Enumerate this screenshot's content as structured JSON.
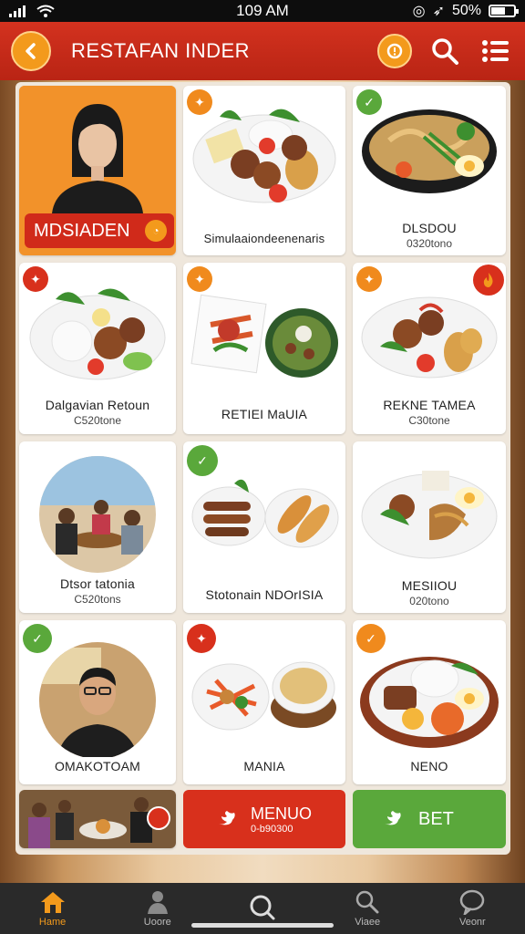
{
  "status": {
    "time": "109 AM",
    "battery": "50%"
  },
  "header": {
    "title": "RESTAFAN INDER"
  },
  "featured": {
    "label": "MDSIADEN"
  },
  "cards": [
    {
      "label": "Simulaaiondeenenaris",
      "sub": ""
    },
    {
      "label": "DLSDOU",
      "sub": "0320tono"
    },
    {
      "label": "Dalgavian Retoun",
      "sub": "C520tone"
    },
    {
      "label": "RETIEI MaUIA",
      "sub": ""
    },
    {
      "label": "REKNE TAMEA",
      "sub": "C30tone"
    },
    {
      "label": "Dtsor tatonia",
      "sub": "C520tons"
    },
    {
      "label": "Stotonain NDOrISIA",
      "sub": ""
    },
    {
      "label": "MESIIOU",
      "sub": "020tono"
    },
    {
      "label": "OMAKOTOAM",
      "sub": ""
    },
    {
      "label": "MANIA",
      "sub": ""
    },
    {
      "label": "NENO",
      "sub": ""
    }
  ],
  "actions": {
    "menu_label": "MENUO",
    "menu_sub": "0-b90300",
    "bet_label": "BET"
  },
  "nav": [
    {
      "label": "Hame",
      "icon": "home-icon"
    },
    {
      "label": "Uoore",
      "icon": "user-icon"
    },
    {
      "label": "",
      "icon": "search-icon"
    },
    {
      "label": "Viaee",
      "icon": "search-people-icon"
    },
    {
      "label": "Veonr",
      "icon": "chat-icon"
    }
  ],
  "colors": {
    "header": "#c62a17",
    "accent": "#f39a1c",
    "green": "#5aa83b",
    "red_btn": "#d8301c"
  }
}
